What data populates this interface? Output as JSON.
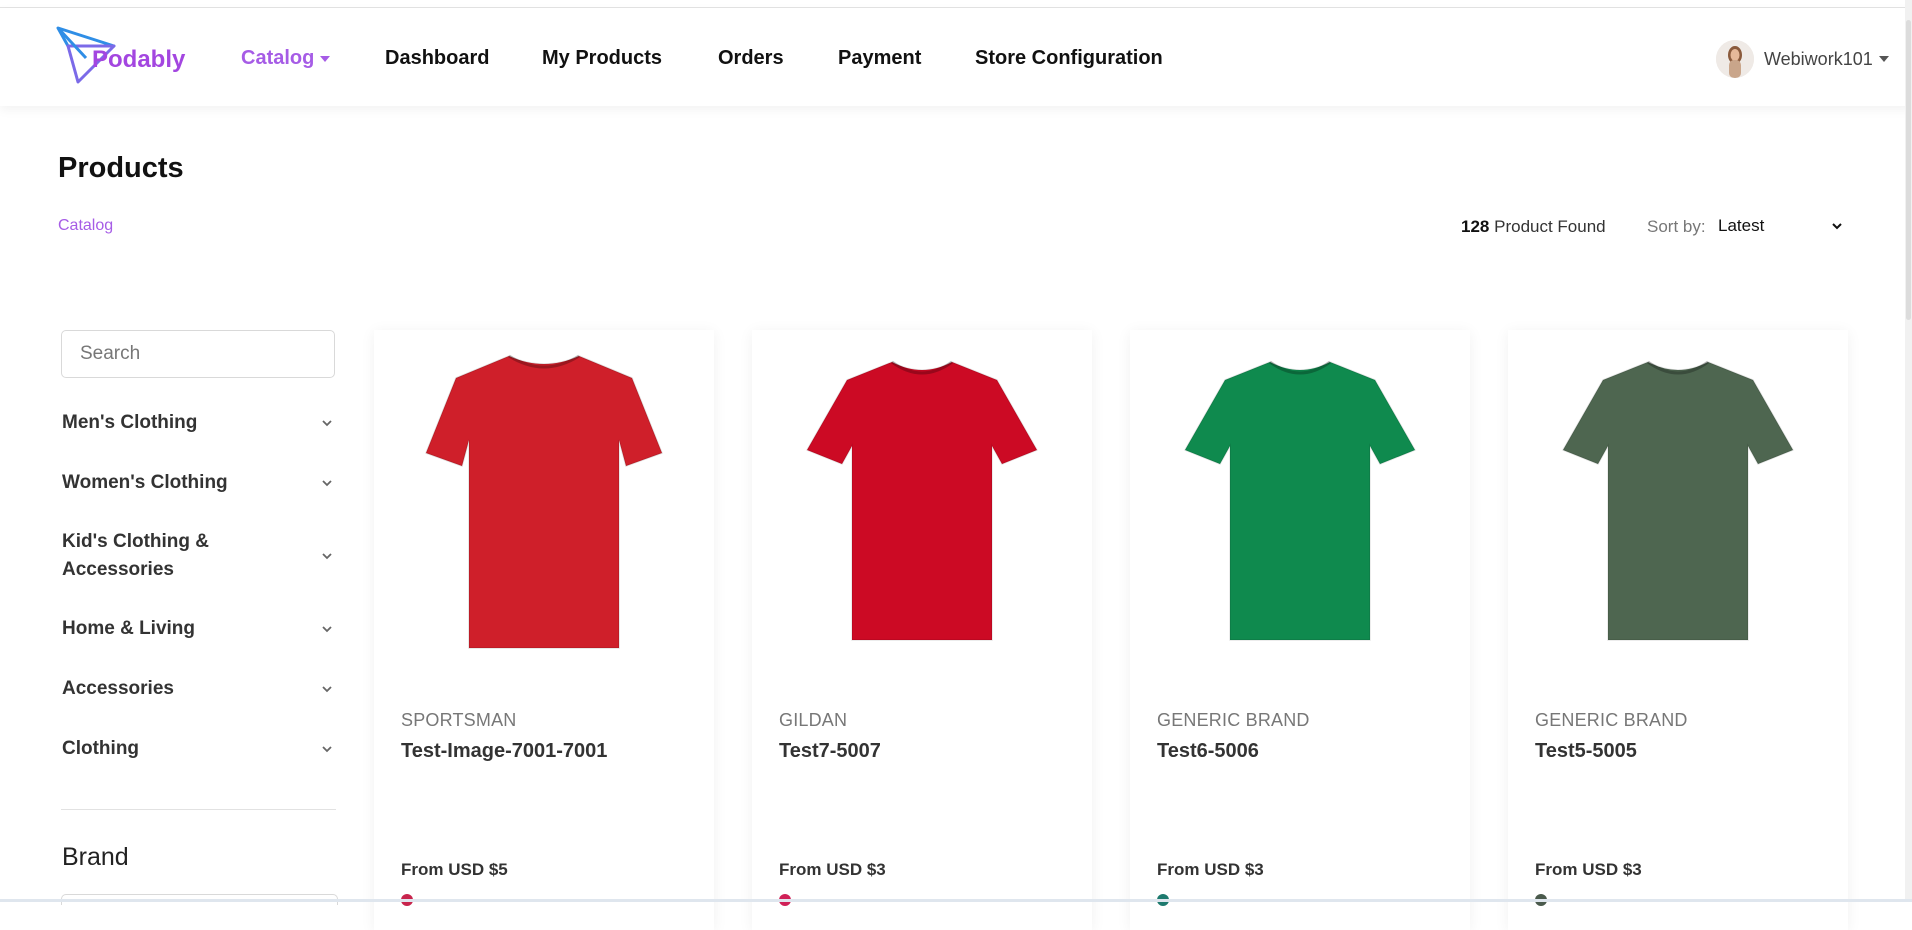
{
  "app": {
    "name": "Podably"
  },
  "colors": {
    "accent": "#a65ce6",
    "logo_blue": "#2f8ee6",
    "logo_purple": "#a346e0"
  },
  "nav": {
    "items": [
      {
        "label": "Catalog",
        "active": true
      },
      {
        "label": "Dashboard"
      },
      {
        "label": "My Products"
      },
      {
        "label": "Orders"
      },
      {
        "label": "Payment"
      },
      {
        "label": "Store Configuration"
      }
    ]
  },
  "user": {
    "name": "Webiwork101"
  },
  "page": {
    "title": "Products",
    "breadcrumb": "Catalog"
  },
  "results": {
    "count": "128",
    "found_label": "Product Found"
  },
  "sort": {
    "label": "Sort by:",
    "selected": "Latest"
  },
  "sidebar": {
    "search_placeholder": "Search",
    "categories": [
      {
        "label": "Men's Clothing"
      },
      {
        "label": "Women's Clothing"
      },
      {
        "label": "Kid's Clothing & Accessories"
      },
      {
        "label": "Home & Living"
      },
      {
        "label": "Accessories"
      },
      {
        "label": "Clothing"
      }
    ],
    "brand_heading": "Brand"
  },
  "products": [
    {
      "brand": "SPORTSMAN",
      "name": "Test-Image-7001-7001",
      "price": "From USD $5",
      "color": "#cf1f2a",
      "swatch": "#c8254d"
    },
    {
      "brand": "GILDAN",
      "name": "Test7-5007",
      "price": "From USD $3",
      "color": "#cc0a24",
      "swatch": "#d02158"
    },
    {
      "brand": "GENERIC BRAND",
      "name": "Test6-5006",
      "price": "From USD $3",
      "color": "#0f8a4e",
      "swatch": "#1e7a6e"
    },
    {
      "brand": "GENERIC BRAND",
      "name": "Test5-5005",
      "price": "From USD $3",
      "color": "#4e6650",
      "swatch": "#4a5a4c"
    }
  ]
}
